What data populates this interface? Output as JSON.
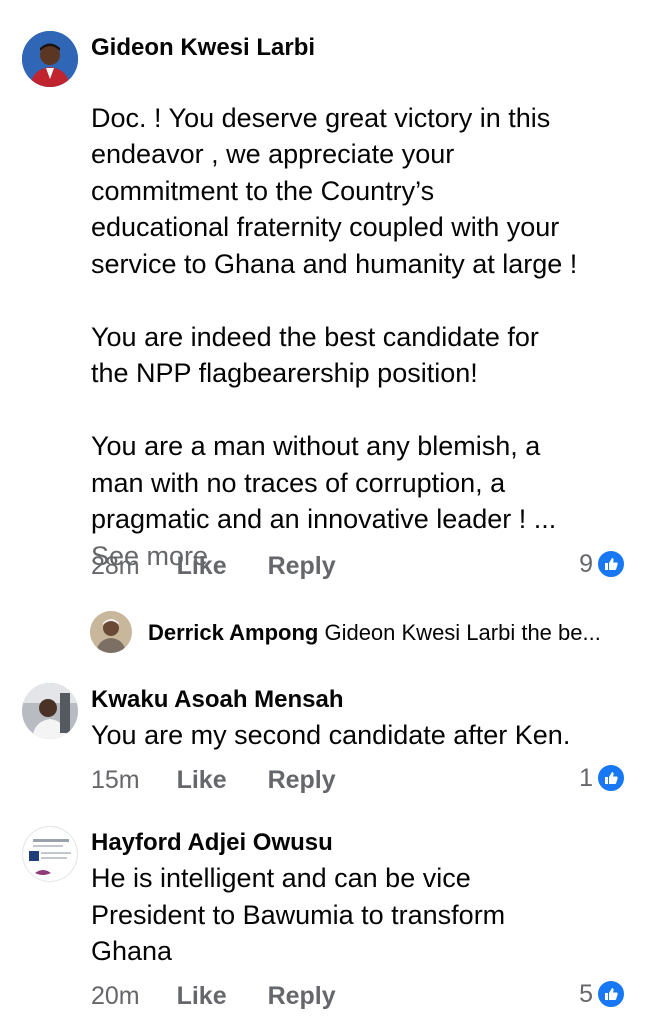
{
  "comments": [
    {
      "author": "Gideon Kwesi Larbi",
      "text": "Doc. ! You deserve great victory in this\nendeavor , we appreciate your\ncommitment to the Country’s\neducational fraternity coupled with your\nservice to Ghana and humanity at large !\n\nYou are indeed the best candidate for\nthe NPP flagbearership position!\n\nYou are a man without any blemish, a\nman with no traces of corruption, a\npragmatic and an innovative leader ! ...",
      "see_more": "See more",
      "time": "28m",
      "like": "Like",
      "reply": "Reply",
      "reaction_count": "9"
    },
    {
      "author": "Kwaku Asoah Mensah",
      "text": "You are my second candidate after Ken.",
      "time": "15m",
      "like": "Like",
      "reply": "Reply",
      "reaction_count": "1"
    },
    {
      "author": "Hayford Adjei Owusu",
      "text": "He is intelligent and can be vice\nPresident to Bawumia to transform\nGhana",
      "time": "20m",
      "like": "Like",
      "reply": "Reply",
      "reaction_count": "5"
    }
  ],
  "reply_preview": {
    "author": "Derrick Ampong",
    "text": "Gideon Kwesi Larbi the be..."
  },
  "colors": {
    "like_blue": "#1877f2",
    "meta_gray": "#65676b",
    "text": "#050505"
  },
  "icons": {
    "reaction": "thumbs-up-icon"
  }
}
